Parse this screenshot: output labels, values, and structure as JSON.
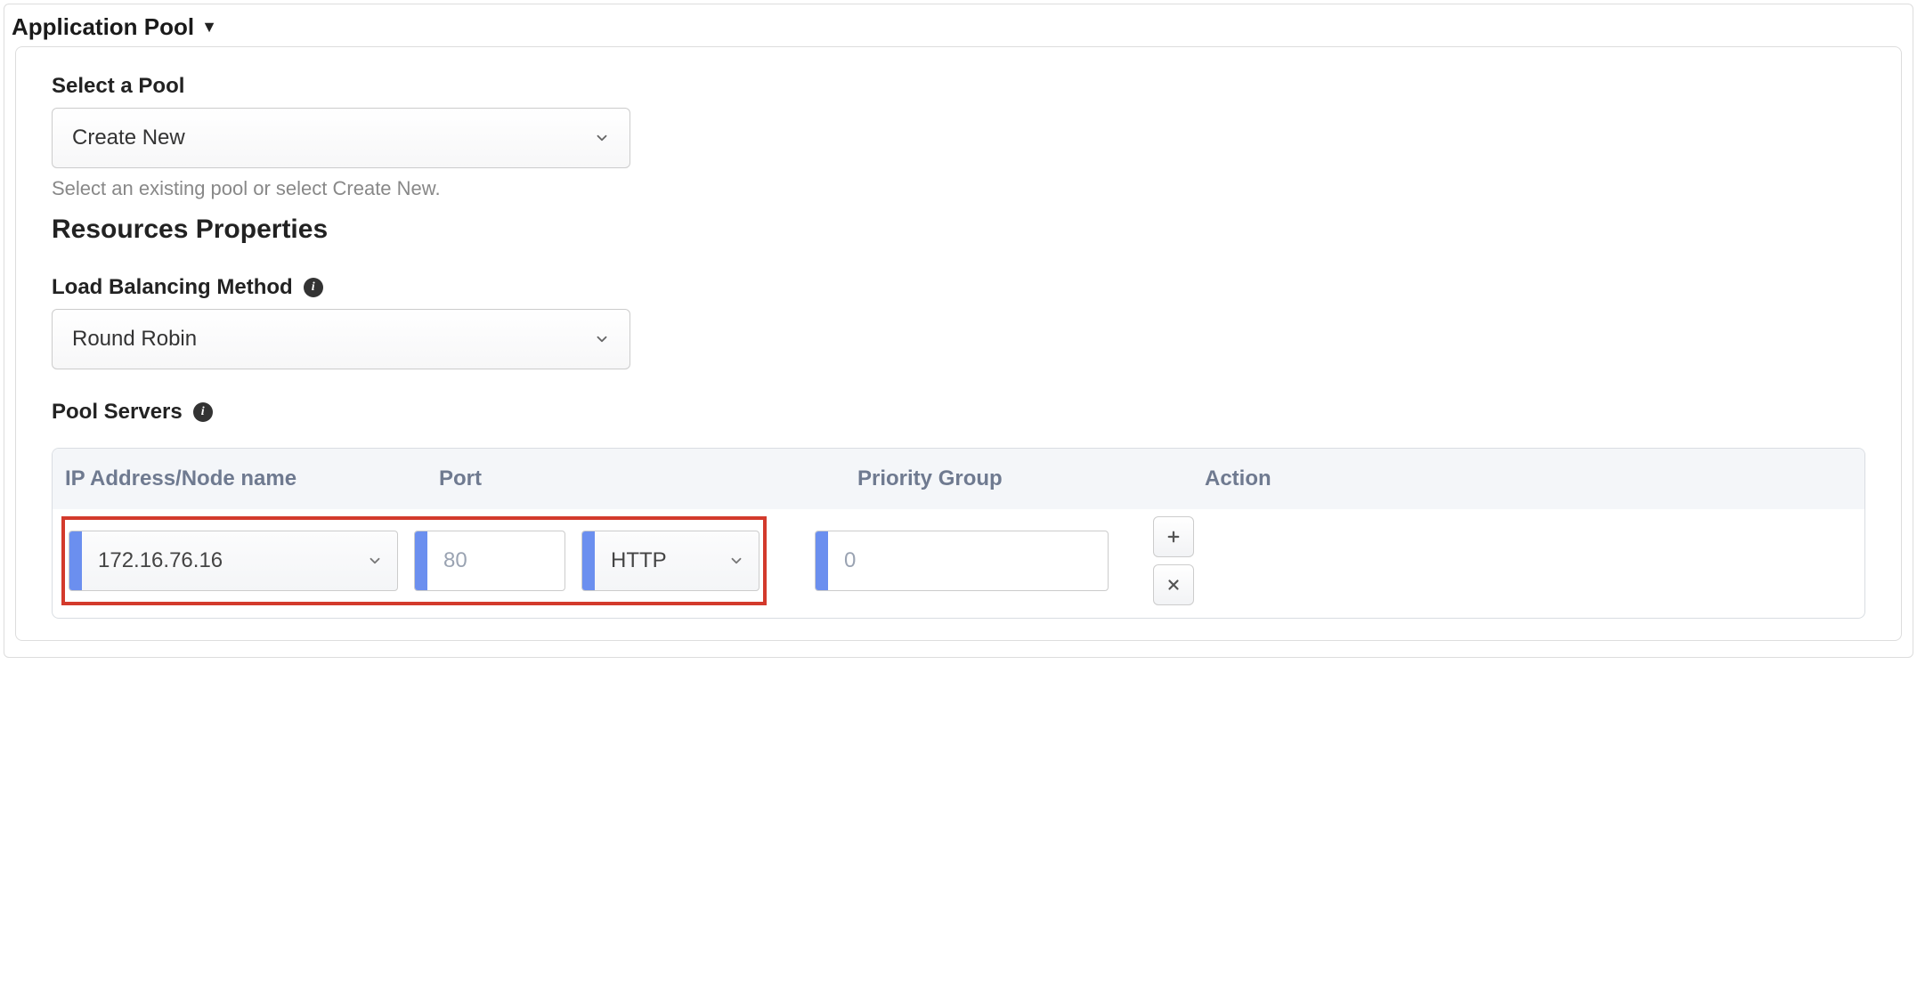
{
  "panel": {
    "title": "Application Pool"
  },
  "select_pool": {
    "label": "Select a Pool",
    "value": "Create New",
    "helper": "Select an existing pool or select Create New."
  },
  "resources_heading": "Resources Properties",
  "lb_method": {
    "label": "Load Balancing Method",
    "value": "Round Robin"
  },
  "pool_servers": {
    "label": "Pool Servers",
    "columns": {
      "ip": "IP Address/Node name",
      "port": "Port",
      "priority": "Priority Group",
      "action": "Action"
    },
    "rows": [
      {
        "ip": "172.16.76.16",
        "port_number_placeholder": "80",
        "port_type": "HTTP",
        "priority_placeholder": "0"
      }
    ]
  }
}
